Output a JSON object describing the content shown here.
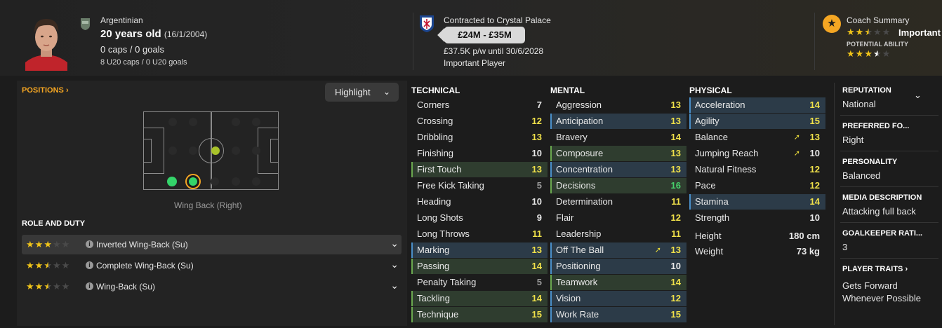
{
  "header": {
    "nationality": "Argentinian",
    "age": "20 years old",
    "dob": "(16/1/2004)",
    "caps": "0 caps / 0 goals",
    "u20": "8 U20 caps / 0 U20 goals",
    "contract": "Contracted to Crystal Palace",
    "value": "£24M - £35M",
    "wage": "£37.5K p/w until 30/6/2028",
    "status": "Important Player",
    "coach_title": "Coach Summary",
    "coach_label": "Important",
    "potential_label": "POTENTIAL ABILITY",
    "current_ability_stars": 2.5,
    "potential_ability_stars": 3.5
  },
  "positions": {
    "title": "POSITIONS",
    "highlight_label": "Highlight",
    "position_caption": "Wing Back (Right)"
  },
  "role_duty": {
    "title": "ROLE AND DUTY",
    "roles": [
      {
        "name": "Inverted Wing-Back (Su)",
        "stars": 3
      },
      {
        "name": "Complete Wing-Back (Su)",
        "stars": 2.5
      },
      {
        "name": "Wing-Back (Su)",
        "stars": 2.5
      }
    ]
  },
  "technical": {
    "title": "TECHNICAL",
    "attrs": [
      {
        "name": "Corners",
        "value": "7"
      },
      {
        "name": "Crossing",
        "value": "12"
      },
      {
        "name": "Dribbling",
        "value": "13"
      },
      {
        "name": "Finishing",
        "value": "10"
      },
      {
        "name": "First Touch",
        "value": "13"
      },
      {
        "name": "Free Kick Taking",
        "value": "5"
      },
      {
        "name": "Heading",
        "value": "10"
      },
      {
        "name": "Long Shots",
        "value": "9"
      },
      {
        "name": "Long Throws",
        "value": "11"
      },
      {
        "name": "Marking",
        "value": "13"
      },
      {
        "name": "Passing",
        "value": "14"
      },
      {
        "name": "Penalty Taking",
        "value": "5"
      },
      {
        "name": "Tackling",
        "value": "14"
      },
      {
        "name": "Technique",
        "value": "15"
      }
    ]
  },
  "mental": {
    "title": "MENTAL",
    "attrs": [
      {
        "name": "Aggression",
        "value": "13"
      },
      {
        "name": "Anticipation",
        "value": "13"
      },
      {
        "name": "Bravery",
        "value": "14"
      },
      {
        "name": "Composure",
        "value": "13"
      },
      {
        "name": "Concentration",
        "value": "13"
      },
      {
        "name": "Decisions",
        "value": "16"
      },
      {
        "name": "Determination",
        "value": "11"
      },
      {
        "name": "Flair",
        "value": "12"
      },
      {
        "name": "Leadership",
        "value": "11"
      },
      {
        "name": "Off The Ball",
        "value": "13"
      },
      {
        "name": "Positioning",
        "value": "10"
      },
      {
        "name": "Teamwork",
        "value": "14"
      },
      {
        "name": "Vision",
        "value": "12"
      },
      {
        "name": "Work Rate",
        "value": "15"
      }
    ]
  },
  "physical": {
    "title": "PHYSICAL",
    "attrs": [
      {
        "name": "Acceleration",
        "value": "14"
      },
      {
        "name": "Agility",
        "value": "15"
      },
      {
        "name": "Balance",
        "value": "13"
      },
      {
        "name": "Jumping Reach",
        "value": "10"
      },
      {
        "name": "Natural Fitness",
        "value": "12"
      },
      {
        "name": "Pace",
        "value": "12"
      },
      {
        "name": "Stamina",
        "value": "14"
      },
      {
        "name": "Strength",
        "value": "10"
      }
    ],
    "height_label": "Height",
    "height": "180 cm",
    "weight_label": "Weight",
    "weight": "73 kg"
  },
  "right_panel": {
    "reputation_h": "REPUTATION",
    "reputation": "National",
    "foot_h": "PREFERRED FO...",
    "foot": "Right",
    "personality_h": "PERSONALITY",
    "personality": "Balanced",
    "media_h": "MEDIA DESCRIPTION",
    "media": "Attacking full back",
    "gk_h": "GOALKEEPER RATI...",
    "gk": "3",
    "traits_h": "PLAYER TRAITS",
    "trait1": "Gets Forward",
    "trait2": "Whenever Possible"
  },
  "colors": {
    "accent": "#f5a623",
    "yellow": "#f0e14a",
    "green": "#47d06b",
    "blue_hl": "#2c3b48",
    "green_hl": "#2f3d2f"
  }
}
